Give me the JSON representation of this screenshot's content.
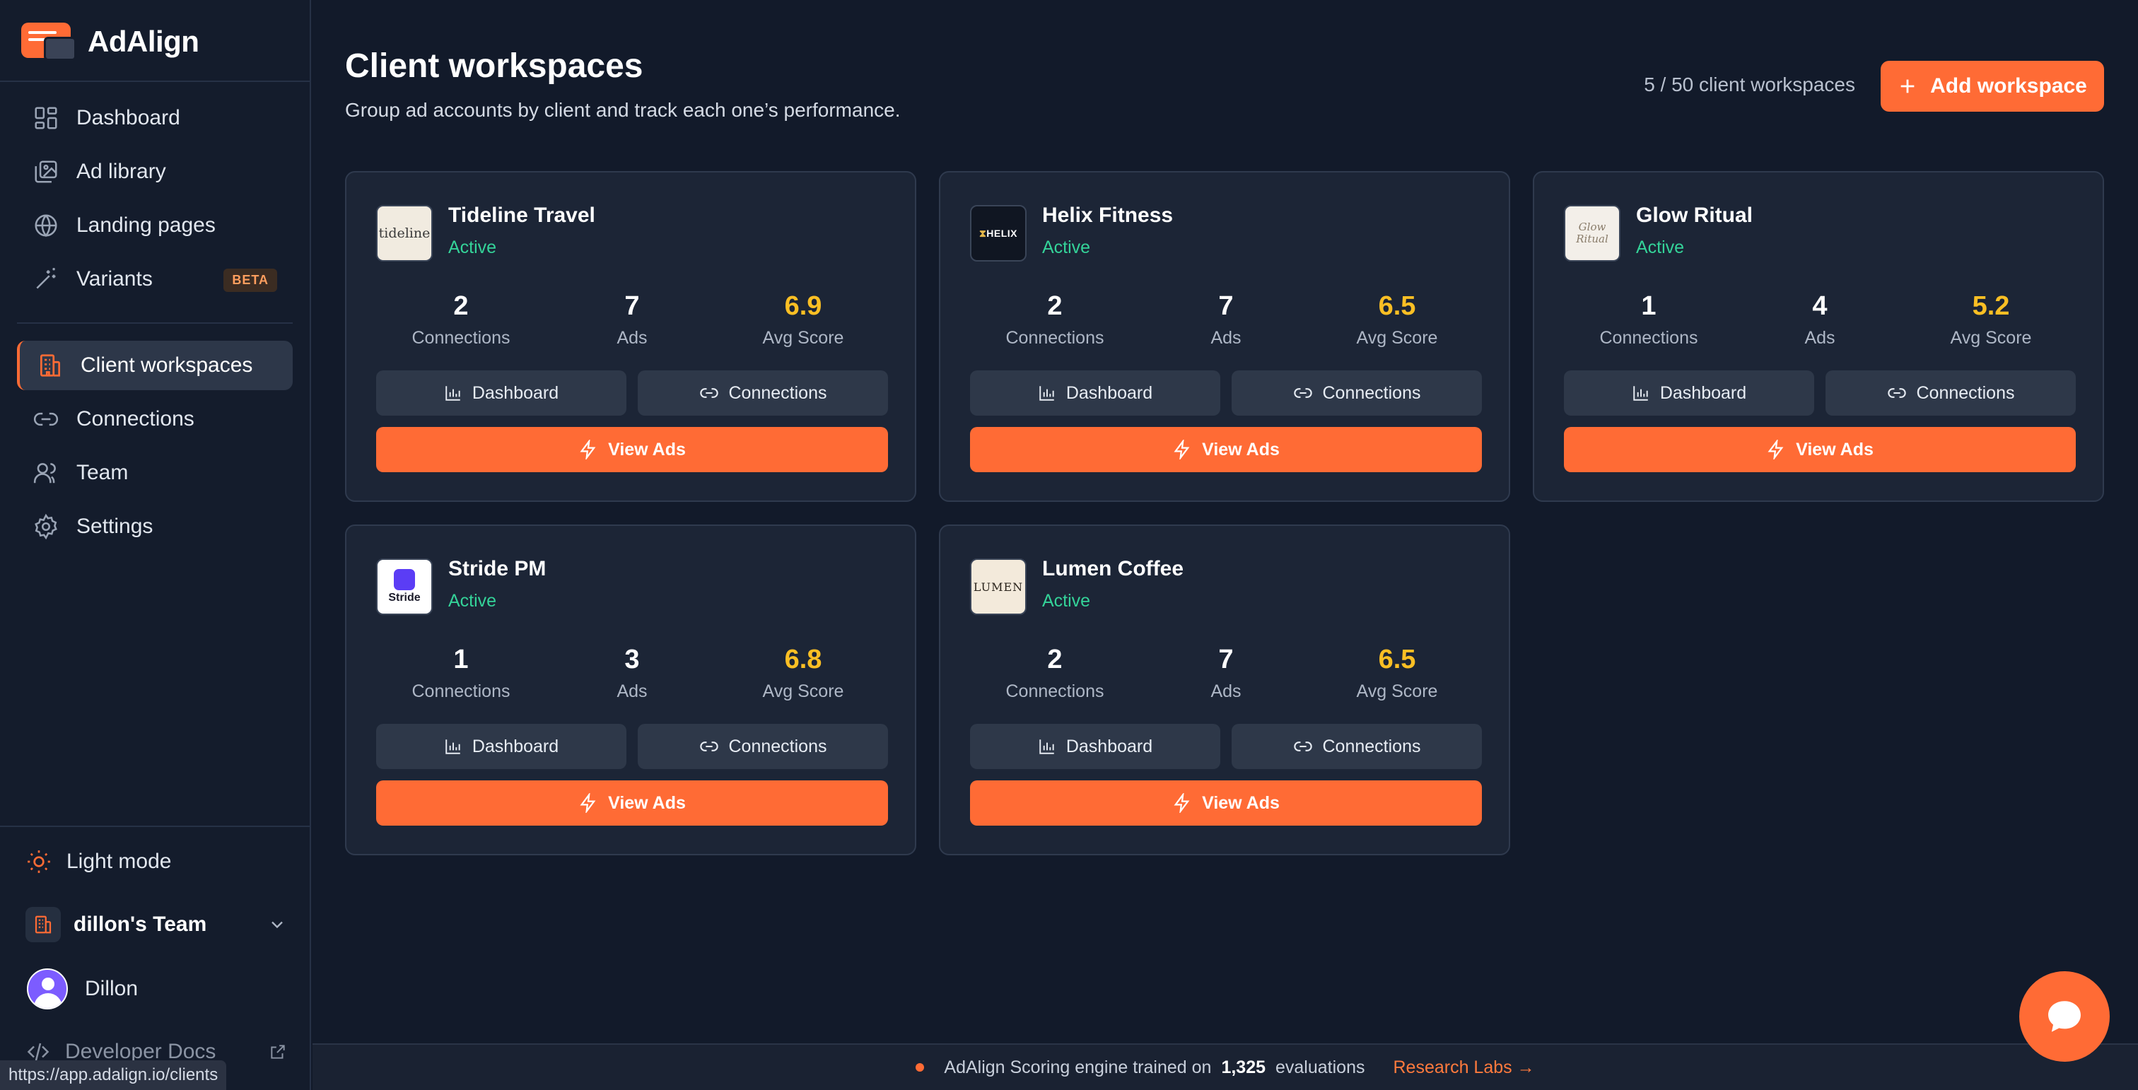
{
  "brand": {
    "name": "AdAlign"
  },
  "sidebar": {
    "nav_main": [
      {
        "label": "Dashboard",
        "icon": "dashboard-icon"
      },
      {
        "label": "Ad library",
        "icon": "image-library-icon"
      },
      {
        "label": "Landing pages",
        "icon": "globe-icon"
      },
      {
        "label": "Variants",
        "icon": "magic-wand-icon",
        "badge": "BETA"
      }
    ],
    "nav_secondary": [
      {
        "label": "Client workspaces",
        "icon": "building-icon",
        "active": true
      },
      {
        "label": "Connections",
        "icon": "link-icon"
      },
      {
        "label": "Team",
        "icon": "users-icon"
      },
      {
        "label": "Settings",
        "icon": "gear-icon"
      }
    ],
    "theme_toggle": "Light mode",
    "team": "dillon's Team",
    "user": "Dillon",
    "developer_docs": "Developer Docs"
  },
  "status_url": "https://app.adalign.io/clients",
  "header": {
    "title": "Client workspaces",
    "subtitle": "Group ad accounts by client and track each one’s performance.",
    "count": "5 / 50 client workspaces",
    "add_button": "Add workspace"
  },
  "card_labels": {
    "connections": "Connections",
    "ads": "Ads",
    "avg_score": "Avg Score",
    "dashboard_button": "Dashboard",
    "connections_button": "Connections",
    "view_ads_button": "View Ads"
  },
  "workspaces": [
    {
      "name": "Tideline Travel",
      "status": "Active",
      "logo_text": "tideline",
      "connections": "2",
      "ads": "7",
      "avg_score": "6.9"
    },
    {
      "name": "Helix Fitness",
      "status": "Active",
      "logo_text": "HELIX",
      "connections": "2",
      "ads": "7",
      "avg_score": "6.5"
    },
    {
      "name": "Glow Ritual",
      "status": "Active",
      "logo_text": "Glow Ritual",
      "connections": "1",
      "ads": "4",
      "avg_score": "5.2"
    },
    {
      "name": "Stride PM",
      "status": "Active",
      "logo_text": "Stride",
      "connections": "1",
      "ads": "3",
      "avg_score": "6.8"
    },
    {
      "name": "Lumen Coffee",
      "status": "Active",
      "logo_text": "LUMEN",
      "connections": "2",
      "ads": "7",
      "avg_score": "6.5"
    }
  ],
  "footer": {
    "text_prefix": "AdAlign Scoring engine trained on",
    "evaluations": "1,325",
    "text_suffix": "evaluations",
    "link": "Research Labs →"
  },
  "colors": {
    "accent": "#ff6b35",
    "active_status": "#34d399",
    "score": "#fbbf24",
    "background": "#121a2a"
  }
}
